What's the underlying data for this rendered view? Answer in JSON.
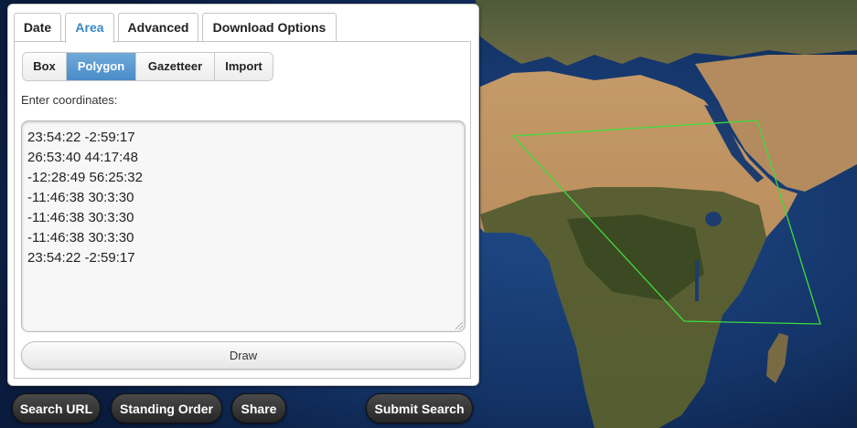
{
  "main_tabs": [
    {
      "label": "Date",
      "active": false
    },
    {
      "label": "Area",
      "active": true
    },
    {
      "label": "Advanced",
      "active": false
    },
    {
      "label": "Download Options",
      "active": false
    }
  ],
  "sub_tabs": [
    {
      "label": "Box",
      "active": false
    },
    {
      "label": "Polygon",
      "active": true
    },
    {
      "label": "Gazetteer",
      "active": false
    },
    {
      "label": "Import",
      "active": false
    }
  ],
  "coordinates_label": "Enter coordinates:",
  "coordinates": [
    "23:54:22 -2:59:17",
    "26:53:40 44:17:48",
    "-12:28:49 56:25:32",
    "-11:46:38 30:3:30",
    "-11:46:38 30:3:30",
    "-11:46:38 30:3:30",
    "23:54:22 -2:59:17"
  ],
  "draw_label": "Draw",
  "bottom_buttons": {
    "search_url": "Search URL",
    "standing_order": "Standing Order",
    "share": "Share",
    "submit_search": "Submit Search"
  },
  "colors": {
    "active_tab_text": "#3a87c8",
    "active_subtab_bg": "#4a8cc8",
    "polygon_outline": "#3ddc3d"
  },
  "map": {
    "imagery": "satellite-earth-africa-middle-east"
  }
}
